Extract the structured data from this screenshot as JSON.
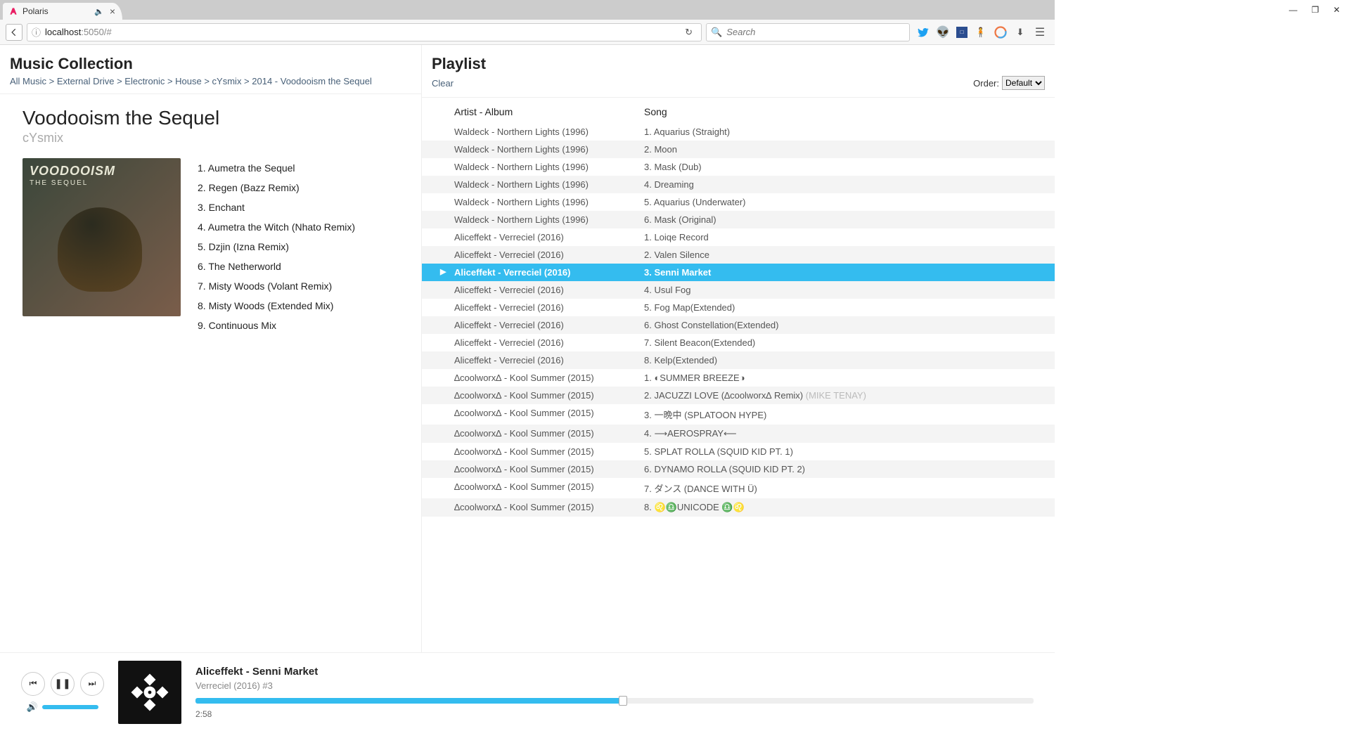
{
  "browser": {
    "tab_title": "Polaris",
    "url_host": "localhost",
    "url_rest": ":5050/#",
    "search_placeholder": "Search"
  },
  "collection": {
    "title": "Music Collection",
    "breadcrumb": "All Music > External Drive > Electronic > House > cYsmix > 2014 - Voodooism the Sequel",
    "album_title": "Voodooism the Sequel",
    "album_artist": "cYsmix",
    "album_art_title": "VOODOOISM",
    "album_art_sub": "THE SEQUEL",
    "tracks": [
      "1. Aumetra the Sequel",
      "2. Regen (Bazz Remix)",
      "3. Enchant",
      "4. Aumetra the Witch (Nhato Remix)",
      "5. Dzjin (Izna Remix)",
      "6. The Netherworld",
      "7. Misty Woods (Volant Remix)",
      "8. Misty Woods (Extended Mix)",
      "9. Continuous Mix"
    ]
  },
  "playlist": {
    "title": "Playlist",
    "clear": "Clear",
    "order_label": "Order:",
    "order_value": "Default",
    "header_artist": "Artist - Album",
    "header_song": "Song",
    "rows": [
      {
        "artist": "Waldeck - Northern Lights (1996)",
        "song": "1. Aquarius (Straight)",
        "extra": "",
        "playing": false
      },
      {
        "artist": "Waldeck - Northern Lights (1996)",
        "song": "2. Moon",
        "extra": "",
        "playing": false
      },
      {
        "artist": "Waldeck - Northern Lights (1996)",
        "song": "3. Mask (Dub)",
        "extra": "",
        "playing": false
      },
      {
        "artist": "Waldeck - Northern Lights (1996)",
        "song": "4. Dreaming",
        "extra": "",
        "playing": false
      },
      {
        "artist": "Waldeck - Northern Lights (1996)",
        "song": "5. Aquarius (Underwater)",
        "extra": "",
        "playing": false
      },
      {
        "artist": "Waldeck - Northern Lights (1996)",
        "song": "6. Mask (Original)",
        "extra": "",
        "playing": false
      },
      {
        "artist": "Aliceffekt - Verreciel (2016)",
        "song": "1. Loiqe Record",
        "extra": "",
        "playing": false
      },
      {
        "artist": "Aliceffekt - Verreciel (2016)",
        "song": "2. Valen Silence",
        "extra": "",
        "playing": false
      },
      {
        "artist": "Aliceffekt - Verreciel (2016)",
        "song": "3. Senni Market",
        "extra": "",
        "playing": true
      },
      {
        "artist": "Aliceffekt - Verreciel (2016)",
        "song": "4. Usul Fog",
        "extra": "",
        "playing": false
      },
      {
        "artist": "Aliceffekt - Verreciel (2016)",
        "song": "5. Fog Map(Extended)",
        "extra": "",
        "playing": false
      },
      {
        "artist": "Aliceffekt - Verreciel (2016)",
        "song": "6. Ghost Constellation(Extended)",
        "extra": "",
        "playing": false
      },
      {
        "artist": "Aliceffekt - Verreciel (2016)",
        "song": "7. Silent Beacon(Extended)",
        "extra": "",
        "playing": false
      },
      {
        "artist": "Aliceffekt - Verreciel (2016)",
        "song": "8. Kelp(Extended)",
        "extra": "",
        "playing": false
      },
      {
        "artist": "∆coolworx∆ - Kool Summer (2015)",
        "song": "1. ◐SUMMER BREEZE◑",
        "extra": "",
        "playing": false
      },
      {
        "artist": "∆coolworx∆ - Kool Summer (2015)",
        "song": "2. JACUZZI LOVE (∆coolworx∆ Remix) ",
        "extra": "(MIKE TENAY)",
        "playing": false
      },
      {
        "artist": "∆coolworx∆ - Kool Summer (2015)",
        "song": "3. 一晩中 (SPLATOON HYPE)",
        "extra": "",
        "playing": false
      },
      {
        "artist": "∆coolworx∆ - Kool Summer (2015)",
        "song": "4. ⟶AEROSPRAY⟵",
        "extra": "",
        "playing": false
      },
      {
        "artist": "∆coolworx∆ - Kool Summer (2015)",
        "song": "5. SPLAT ROLLA (SQUID KID PT. 1)",
        "extra": "",
        "playing": false
      },
      {
        "artist": "∆coolworx∆ - Kool Summer (2015)",
        "song": "6. DYNAMO ROLLA (SQUID KID PT. 2)",
        "extra": "",
        "playing": false
      },
      {
        "artist": "∆coolworx∆ - Kool Summer (2015)",
        "song": "7. ダンス  (DANCE WITH Ü)",
        "extra": "",
        "playing": false
      },
      {
        "artist": "∆coolworx∆ - Kool Summer (2015)",
        "song": "8. ♌♎UNICODE ♎♌",
        "extra": "",
        "playing": false
      }
    ]
  },
  "player": {
    "now_title": "Aliceffekt - Senni Market",
    "now_sub": "Verreciel (2016) #3",
    "elapsed": "2:58"
  }
}
